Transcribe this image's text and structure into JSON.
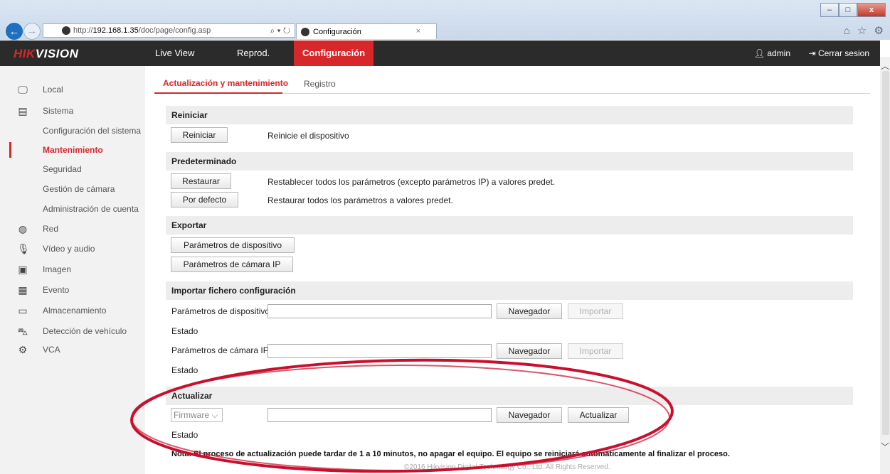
{
  "browser": {
    "url_prefix": "http://",
    "url_host": "192.168.1.35",
    "url_path": "/doc/page/config.asp",
    "address_icons": "⌕ ▾ ↻",
    "tab_title": "Configuración",
    "tab_close": "×",
    "window_buttons": {
      "minimize": "–",
      "maximize": "□",
      "close": "x"
    },
    "toolbar_icons": "⌂ ☆ ⚙"
  },
  "app": {
    "logo_red": "HIK",
    "logo_white": "VISION",
    "nav": [
      "Live View",
      "Reprod.",
      "Configuración"
    ],
    "user": "admin",
    "logout": "Cerrar sesion",
    "user_icon": "person-icon",
    "logout_icon": "logout-icon"
  },
  "sidebar": {
    "items": [
      {
        "label": "Local",
        "icon": "monitor-icon",
        "glyph": "🖵"
      },
      {
        "label": "Sistema",
        "icon": "window-icon",
        "glyph": "▤"
      },
      {
        "label": "Configuración del sistema"
      },
      {
        "label": "Mantenimiento",
        "active": true
      },
      {
        "label": "Seguridad"
      },
      {
        "label": "Gestión de cámara"
      },
      {
        "label": "Administración de cuenta"
      },
      {
        "label": "Red",
        "icon": "globe-icon",
        "glyph": "◍"
      },
      {
        "label": "Vídeo y audio",
        "icon": "mic-icon",
        "glyph": "🎙"
      },
      {
        "label": "Imagen",
        "icon": "image-icon",
        "glyph": "▣"
      },
      {
        "label": "Evento",
        "icon": "calendar-icon",
        "glyph": "▦"
      },
      {
        "label": "Almacenamiento",
        "icon": "storage-icon",
        "glyph": "▭"
      },
      {
        "label": "Detección de vehículo",
        "icon": "vehicle-icon",
        "glyph": "⛍"
      },
      {
        "label": "VCA",
        "icon": "vca-icon",
        "glyph": "⚙"
      }
    ]
  },
  "content": {
    "tabs": [
      "Actualización y mantenimiento",
      "Registro"
    ],
    "reboot": {
      "title": "Reiniciar",
      "button": "Reiniciar",
      "desc": "Reinicie el dispositivo"
    },
    "default": {
      "title": "Predeterminado",
      "restore_button": "Restaurar",
      "restore_desc": "Restablecer todos los parámetros (excepto parámetros IP) a valores predet.",
      "default_button": "Por defecto",
      "default_desc": "Restaurar todos los parámetros a valores predet."
    },
    "export": {
      "title": "Exportar",
      "device_button": "Parámetros de dispositivo",
      "camera_button": "Parámetros de cámara IP"
    },
    "import": {
      "title": "Importar fichero configuración",
      "device_label": "Parámetros de dispositivo",
      "camera_label": "Parámetros de cámara IP",
      "browse": "Navegador",
      "import": "Importar",
      "status": "Estado"
    },
    "upgrade": {
      "title": "Actualizar",
      "select_value": "Firmware",
      "browse": "Navegador",
      "upgrade_button": "Actualizar",
      "status": "Estado"
    },
    "note": "Nota: El proceso de actualización puede tardar de 1 a 10 minutos, no apagar el equipo. El equipo se reiniciará automáticamente al finalizar el proceso.",
    "copyright": "©2016 Hikvision Digital Technology Co., Ltd. All Rights Reserved."
  },
  "colors": {
    "accent": "#d7272b",
    "annotation": "#c8102e"
  }
}
